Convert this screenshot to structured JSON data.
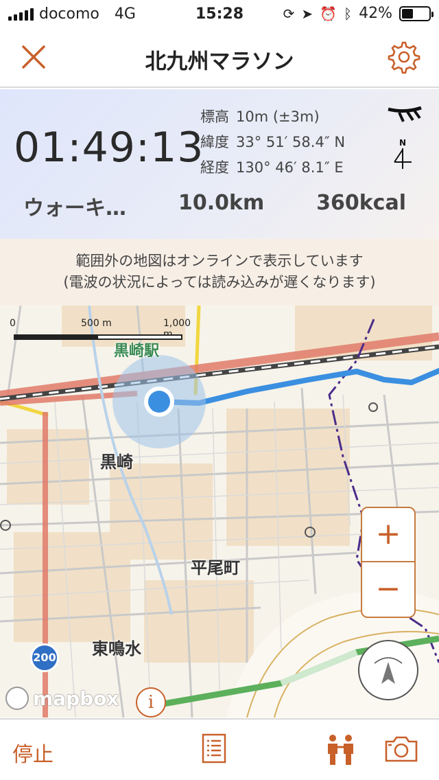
{
  "status_bar": {
    "carrier": "docomo",
    "network": "4G",
    "time": "15:28",
    "battery": "42%",
    "battery_level": 0.42
  },
  "nav": {
    "title": "北九州マラソン"
  },
  "info": {
    "elapsed": "01:49:13",
    "altitude_label": "標高",
    "altitude_value": "10m (±3m)",
    "latitude_label": "緯度",
    "latitude_value": "33° 51′ 58.4″ N",
    "longitude_label": "経度",
    "longitude_value": "130° 46′ 8.1″ E",
    "compass_letter": "N",
    "activity": "ウォーキ…",
    "distance": "10.0km",
    "calories": "360kcal"
  },
  "notice": {
    "line1": "範囲外の地図はオンラインで表示しています",
    "line2": "(電波の状況によっては読み込みが遅くなります)"
  },
  "map": {
    "scale_labels": [
      "0",
      "500 m",
      "1,000 m"
    ],
    "places": {
      "station": "黒崎駅",
      "kurosaki": "黒崎",
      "hiraomachi": "平尾町",
      "higashinarumizu": "東鳴水"
    },
    "route_number": "200",
    "zoom_in": "+",
    "zoom_out": "−",
    "attribution": "mapbox",
    "info_glyph": "i"
  },
  "toolbar": {
    "stop_label": "停止"
  },
  "colors": {
    "accent": "#c8602a",
    "route": "#3b8fe0",
    "rail": "#e07a6a",
    "location": "#3b8fe0"
  }
}
